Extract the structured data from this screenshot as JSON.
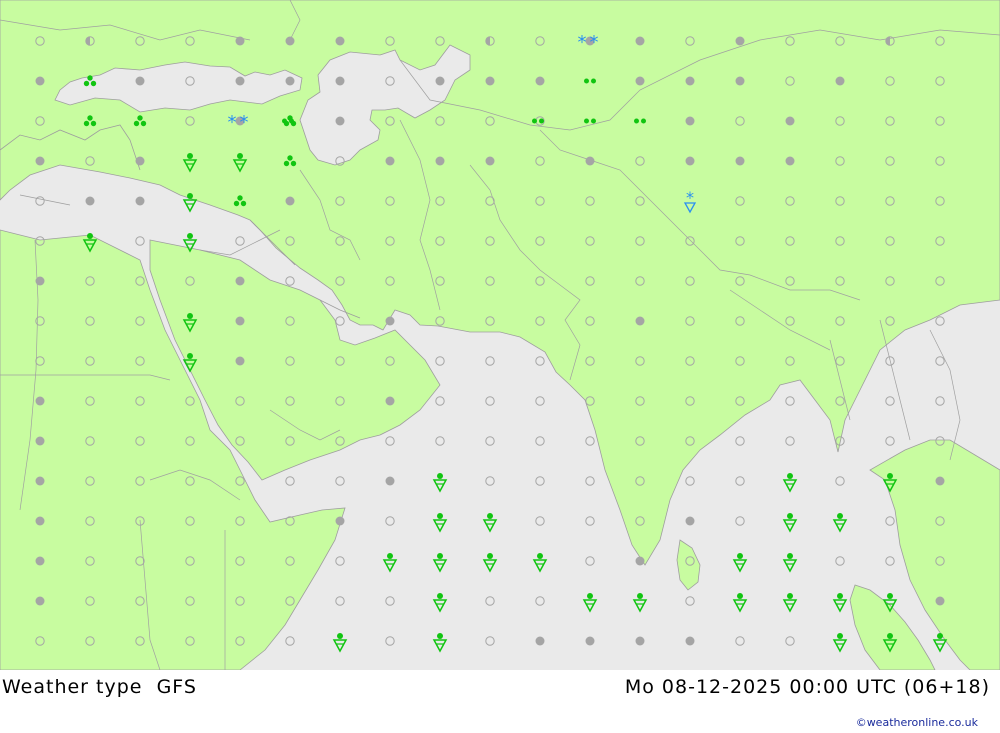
{
  "title": "Weather type",
  "model": "GFS",
  "datetime": "Mo 08-12-2025 00:00 UTC (06+18)",
  "credit": "©weatheronline.co.uk",
  "colors": {
    "land": "#c8fca0",
    "sea": "#eaeaea",
    "border": "#a0a0a0",
    "coast": "#9e9e9e",
    "marker_gray": "#a5a5a5",
    "precip_green": "#11c511",
    "snow_blue": "#2a8ff0"
  },
  "legend_symbols": {
    "clear": "empty-circle",
    "partly_cloudy": "half-circle",
    "cloudy": "filled-circle",
    "rain_showers": "green-shower-symbol",
    "heavy_rain": "green-three-dots",
    "light_rain": "green-two-dots",
    "snow": "blue-asterisks",
    "snow_showers": "blue-snow-shower"
  }
}
